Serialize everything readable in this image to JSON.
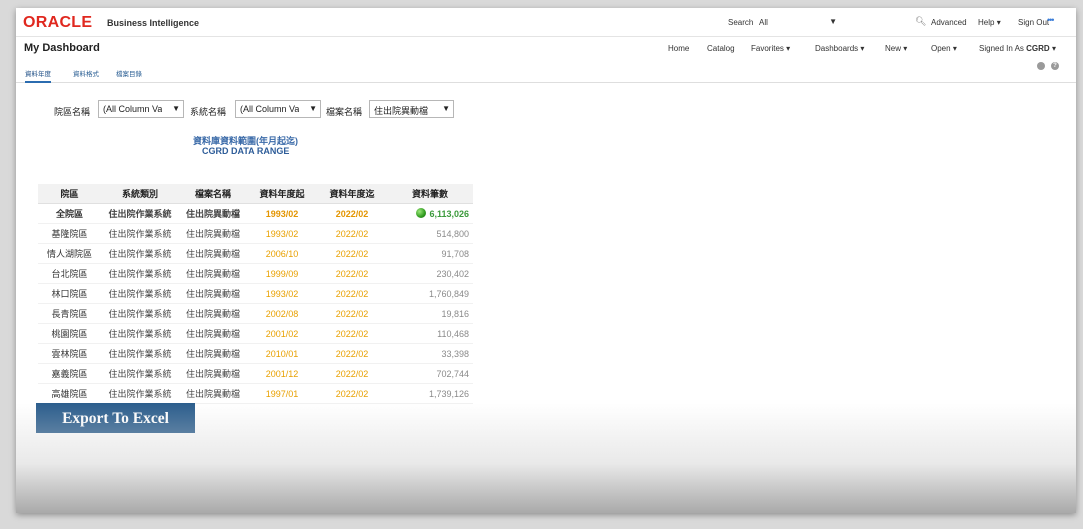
{
  "brand": {
    "logo": "ORACLE",
    "product": "Business Intelligence"
  },
  "topbar": {
    "search_label": "Search",
    "search_scope": "All",
    "advanced": "Advanced",
    "help": "Help",
    "sign_out": "Sign Out"
  },
  "header": {
    "title": "My Dashboard",
    "nav": {
      "home": "Home",
      "catalog": "Catalog",
      "favorites": "Favorites",
      "dashboards": "Dashboards",
      "new": "New",
      "open": "Open",
      "signed_in_as": "Signed In As",
      "user": "CGRD"
    }
  },
  "tabs": [
    "資料年度",
    "資料格式",
    "檔案目錄"
  ],
  "prompts": [
    {
      "label": "院區名稱",
      "value": "(All Column Va"
    },
    {
      "label": "系統名稱",
      "value": "(All Column Va"
    },
    {
      "label": "檔案名稱",
      "value": "住出院異動檔"
    }
  ],
  "report": {
    "title_zh": "資料庫資料範圍(年月起迄)",
    "title_en": "CGRD DATA RANGE"
  },
  "table": {
    "headers": [
      "院區",
      "系統類別",
      "檔案名稱",
      "資料年度起",
      "資料年度迄",
      "資料筆數"
    ],
    "total": {
      "campus": "全院區",
      "system": "住出院作業系統",
      "file": "住出院異動檔",
      "start": "1993/02",
      "end": "2022/02",
      "count": "6,113,026"
    },
    "rows": [
      {
        "campus": "基隆院區",
        "system": "住出院作業系統",
        "file": "住出院異動檔",
        "start": "1993/02",
        "end": "2022/02",
        "count": "514,800"
      },
      {
        "campus": "情人湖院區",
        "system": "住出院作業系統",
        "file": "住出院異動檔",
        "start": "2006/10",
        "end": "2022/02",
        "count": "91,708"
      },
      {
        "campus": "台北院區",
        "system": "住出院作業系統",
        "file": "住出院異動檔",
        "start": "1999/09",
        "end": "2022/02",
        "count": "230,402"
      },
      {
        "campus": "林口院區",
        "system": "住出院作業系統",
        "file": "住出院異動檔",
        "start": "1993/02",
        "end": "2022/02",
        "count": "1,760,849"
      },
      {
        "campus": "長青院區",
        "system": "住出院作業系統",
        "file": "住出院異動檔",
        "start": "2002/08",
        "end": "2022/02",
        "count": "19,816"
      },
      {
        "campus": "桃園院區",
        "system": "住出院作業系統",
        "file": "住出院異動檔",
        "start": "2001/02",
        "end": "2022/02",
        "count": "110,468"
      },
      {
        "campus": "雲林院區",
        "system": "住出院作業系統",
        "file": "住出院異動檔",
        "start": "2010/01",
        "end": "2022/02",
        "count": "33,398"
      },
      {
        "campus": "嘉義院區",
        "system": "住出院作業系統",
        "file": "住出院異動檔",
        "start": "2001/12",
        "end": "2022/02",
        "count": "702,744"
      },
      {
        "campus": "高雄院區",
        "system": "住出院作業系統",
        "file": "住出院異動檔",
        "start": "1997/01",
        "end": "2022/02",
        "count": "1,739,126"
      }
    ]
  },
  "export_button": "Export To Excel",
  "colors": {
    "brand": "#e0281f",
    "accent": "#2c5e8d",
    "date": "#e8a000",
    "status_ok": "#2f9a1e"
  },
  "icons": {
    "search": "search-icon",
    "more": "more-icon",
    "gear": "gear-icon",
    "help": "help-icon",
    "status": "green-status-icon"
  }
}
